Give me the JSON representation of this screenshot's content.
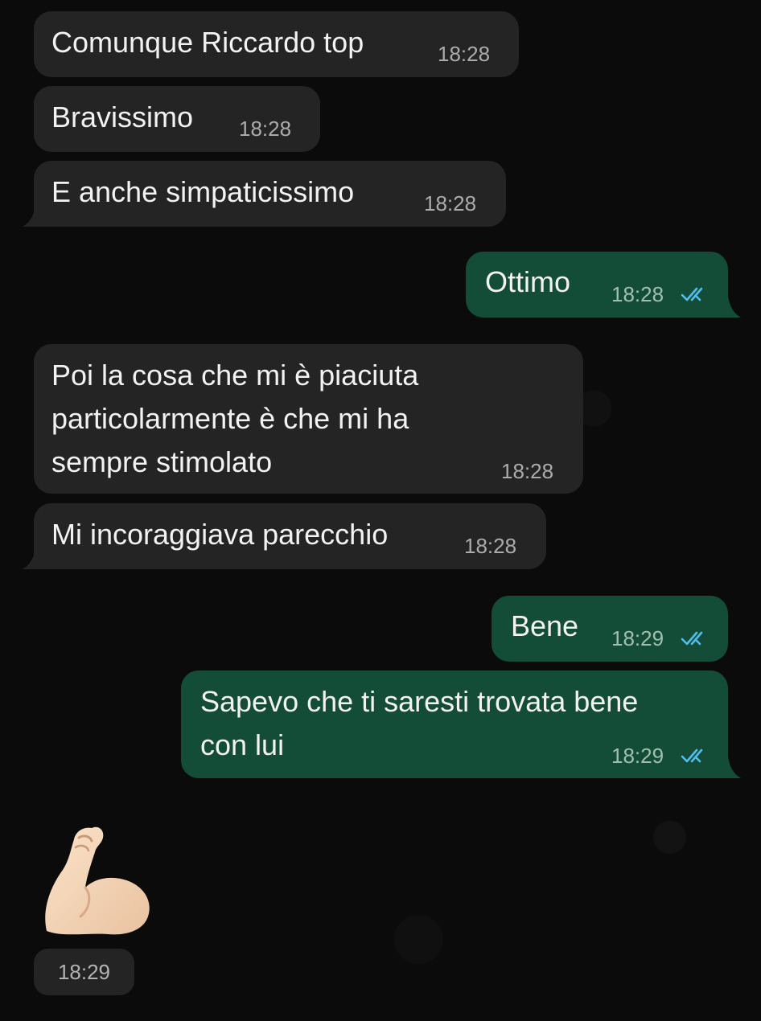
{
  "messages": [
    {
      "text": "Comunque Riccardo top",
      "time": "18:28"
    },
    {
      "text": "Bravissimo",
      "time": "18:28"
    },
    {
      "text": "E anche simpaticissimo",
      "time": "18:28"
    },
    {
      "text": "Ottimo",
      "time": "18:28"
    },
    {
      "text": "Poi la cosa che mi è piaciuta\nparticolarmente è che mi ha\nsempre stimolato",
      "time": "18:28"
    },
    {
      "text": "Mi incoraggiava parecchio",
      "time": "18:28"
    },
    {
      "text": "Bene",
      "time": "18:29"
    },
    {
      "text": "Sapevo che ti saresti trovata bene\ncon lui",
      "time": "18:29"
    }
  ],
  "sticker": {
    "icon": "flexed-biceps-icon",
    "time": "18:29"
  },
  "colors": {
    "background": "#0b0b0b",
    "incoming_bubble": "#242424",
    "outgoing_bubble": "#144d37",
    "read_ticks": "#53bdeb"
  },
  "read_receipt_icon": "double-check-icon"
}
